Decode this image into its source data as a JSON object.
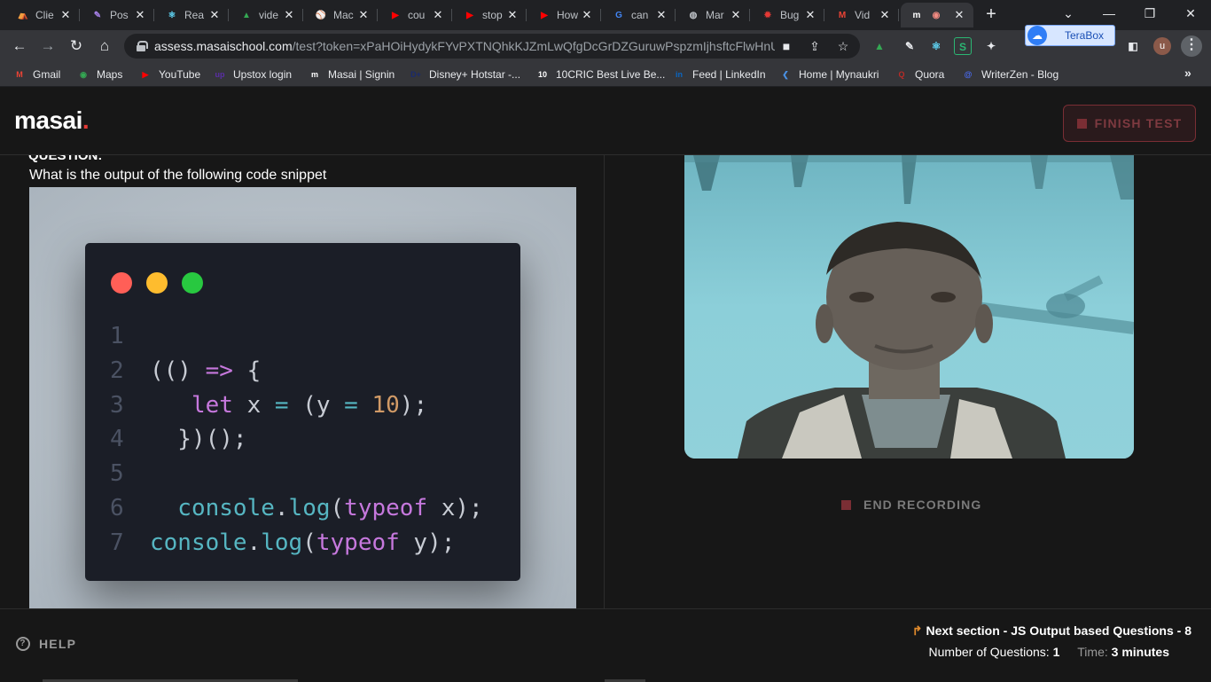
{
  "browser": {
    "tabs": [
      {
        "title": "Clie",
        "icon": "tent-icon",
        "color": "#e53935",
        "glyph": "⛺"
      },
      {
        "title": "Pos",
        "icon": "feather-icon",
        "color": "#a57fe6",
        "glyph": "✎"
      },
      {
        "title": "Rea",
        "icon": "react-icon",
        "color": "#61dafb",
        "glyph": "⚛"
      },
      {
        "title": "vide",
        "icon": "google-drive-icon",
        "color": "#34a853",
        "glyph": "▲"
      },
      {
        "title": "Mac",
        "icon": "baseball-icon",
        "color": "#ffffff",
        "glyph": "⚾"
      },
      {
        "title": "cou",
        "icon": "youtube-icon",
        "color": "#ff0000",
        "glyph": "▶"
      },
      {
        "title": "stop",
        "icon": "youtube-icon",
        "color": "#ff0000",
        "glyph": "▶"
      },
      {
        "title": "How",
        "icon": "youtube-icon",
        "color": "#ff0000",
        "glyph": "▶"
      },
      {
        "title": "can",
        "icon": "google-icon",
        "color": "#4285f4",
        "glyph": "G"
      },
      {
        "title": "Mar",
        "icon": "globe-icon",
        "color": "#bdc1c6",
        "glyph": "◍"
      },
      {
        "title": "Bug",
        "icon": "bug-icon",
        "color": "#e53935",
        "glyph": "✹"
      },
      {
        "title": "Vid",
        "icon": "gmail-icon",
        "color": "#ea4335",
        "glyph": "M"
      },
      {
        "title": "",
        "icon": "masai-icon",
        "color": "#ffffff",
        "glyph": "m",
        "active": true
      }
    ],
    "new_tab": "+",
    "window_controls": {
      "minimize": "—",
      "chevron": "⌄",
      "restore": "❐",
      "close": "✕"
    },
    "url_host": "assess.masaischool.com",
    "url_path": "/test?token=xPaHOiHydykFYvPXTNQhkKJZmLwQfgDcGrDZGuruwPspzmIjhsftcFlwHnUf...",
    "terabox_label": "TeraBox",
    "profile_initial": "u",
    "bookmarks": [
      {
        "label": "Gmail",
        "icon": "gmail-icon",
        "color": "#ea4335",
        "glyph": "M"
      },
      {
        "label": "Maps",
        "icon": "maps-pin-icon",
        "color": "#34a853",
        "glyph": "◉"
      },
      {
        "label": "YouTube",
        "icon": "youtube-icon",
        "color": "#ff0000",
        "glyph": "▶"
      },
      {
        "label": "Upstox login",
        "icon": "upstox-icon",
        "color": "#5a2ea6",
        "glyph": "up"
      },
      {
        "label": "Masai | Signin",
        "icon": "masai-icon",
        "color": "#ffffff",
        "glyph": "m"
      },
      {
        "label": "Disney+ Hotstar -...",
        "icon": "hotstar-icon",
        "color": "#1a2b6d",
        "glyph": "D+"
      },
      {
        "label": "10CRIC Best Live Be...",
        "icon": "10cric-icon",
        "color": "#ffffff",
        "glyph": "10"
      },
      {
        "label": "Feed | LinkedIn",
        "icon": "linkedin-icon",
        "color": "#0a66c2",
        "glyph": "in"
      },
      {
        "label": "Home | Mynaukri",
        "icon": "mynaukri-icon",
        "color": "#4a90e2",
        "glyph": "❮"
      },
      {
        "label": "Quora",
        "icon": "quora-icon",
        "color": "#b92b27",
        "glyph": "Q"
      },
      {
        "label": "WriterZen - Blog",
        "icon": "writerzen-icon",
        "color": "#4a6cf7",
        "glyph": "@"
      }
    ],
    "bookmarks_more": "»"
  },
  "app": {
    "logo_text": "masai",
    "logo_dot": ".",
    "finish_label": "FINISH TEST",
    "question_label": "QUESTION:",
    "question_text": "What is the output of the following code snippet",
    "code_lines": [
      {
        "n": "1",
        "tokens": []
      },
      {
        "n": "2",
        "tokens": [
          {
            "t": "(()",
            "c": "pn"
          },
          {
            "t": " => ",
            "c": "kw"
          },
          {
            "t": "{",
            "c": "pn"
          }
        ]
      },
      {
        "n": "3",
        "tokens": [
          {
            "t": "   let",
            "c": "kw"
          },
          {
            "t": " x ",
            "c": "pn"
          },
          {
            "t": "=",
            "c": "op"
          },
          {
            "t": " (y ",
            "c": "pn"
          },
          {
            "t": "=",
            "c": "op"
          },
          {
            "t": " ",
            "c": "pn"
          },
          {
            "t": "10",
            "c": "num"
          },
          {
            "t": ");",
            "c": "pn"
          }
        ]
      },
      {
        "n": "4",
        "tokens": [
          {
            "t": "  })();",
            "c": "pn"
          }
        ]
      },
      {
        "n": "5",
        "tokens": []
      },
      {
        "n": "6",
        "tokens": [
          {
            "t": "  console",
            "c": "fn"
          },
          {
            "t": ".",
            "c": "pn"
          },
          {
            "t": "log",
            "c": "fn"
          },
          {
            "t": "(",
            "c": "pn"
          },
          {
            "t": "typeof",
            "c": "kw"
          },
          {
            "t": " x);",
            "c": "pn"
          }
        ]
      },
      {
        "n": "7",
        "tokens": [
          {
            "t": "console",
            "c": "fn"
          },
          {
            "t": ".",
            "c": "pn"
          },
          {
            "t": "log",
            "c": "fn"
          },
          {
            "t": "(",
            "c": "pn"
          },
          {
            "t": "typeof",
            "c": "kw"
          },
          {
            "t": " y);",
            "c": "pn"
          }
        ]
      }
    ],
    "window_dots": [
      "#ff5f57",
      "#febc2e",
      "#28c840"
    ],
    "end_recording_label": "END RECORDING",
    "help_label": "HELP",
    "next_section": "Next section - JS Output based Questions - 8",
    "num_questions_label": "Number of Questions:",
    "num_questions": "1",
    "time_label": "Time:",
    "time_value": "3 minutes"
  }
}
